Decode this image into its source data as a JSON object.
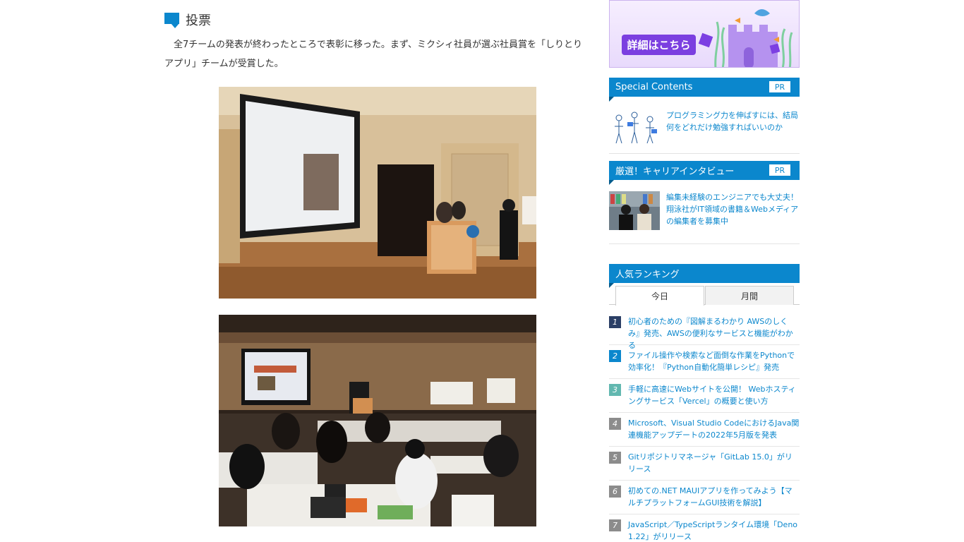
{
  "article": {
    "heading": "投票",
    "paragraph": "全7チームの発表が終わったところで表彰に移った。まず、ミクシィ社員が選ぶ社員賞を「しりとりアプリ」チームが受賞した。"
  },
  "sidebar": {
    "ad": {
      "button_label": "詳細はこちら"
    },
    "special": {
      "title": "Special Contents",
      "badge": "PR",
      "item_text": "プログラミング力を伸ばすには、結局何をどれだけ勉強すればいいのか"
    },
    "career": {
      "title": "厳選！キャリアインタビュー",
      "badge": "PR",
      "item_text": "編集未経験のエンジニアでも大丈夫！翔泳社がIT領域の書籍＆Webメディアの編集者を募集中"
    },
    "ranking": {
      "title": "人気ランキング",
      "tabs": [
        "今日",
        "月間"
      ],
      "items": [
        {
          "num": "1",
          "color": "#2b3f66",
          "text": "初心者のための『図解まるわかり AWSのしくみ』発売、AWSの便利なサービスと機能がわかる"
        },
        {
          "num": "2",
          "color": "#0b87cd",
          "text": "ファイル操作や検索など面倒な作業をPythonで効率化！『Python自動化簡単レシピ』発売"
        },
        {
          "num": "3",
          "color": "#62b8b0",
          "text": "手軽に高速にWebサイトを公開！ Webホスティングサービス「Vercel」の概要と使い方"
        },
        {
          "num": "4",
          "color": "#8c8c8c",
          "text": "Microsoft、Visual Studio CodeにおけるJava関連機能アップデートの2022年5月版を発表"
        },
        {
          "num": "5",
          "color": "#8c8c8c",
          "text": "Gitリポジトリマネージャ「GitLab 15.0」がリリース"
        },
        {
          "num": "6",
          "color": "#8c8c8c",
          "text": "初めての.NET MAUIアプリを作ってみよう【マルチプラットフォームGUI技術を解説】"
        },
        {
          "num": "7",
          "color": "#8c8c8c",
          "text": "JavaScript／TypeScriptランタイム環境「Deno 1.22」がリリース"
        }
      ]
    }
  }
}
